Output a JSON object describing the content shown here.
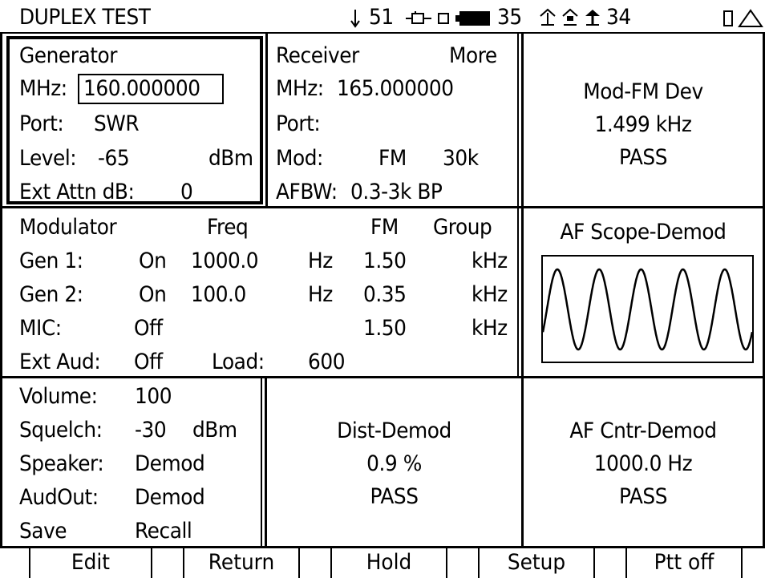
{
  "title_bar": {
    "title": "DUPLEX TEST",
    "arrow_value": "51",
    "battery_value": "35",
    "signal_value": "34"
  },
  "generator": {
    "title": "Generator",
    "mhz_label": "MHz:",
    "mhz_value": "160.000000",
    "port_label": "Port:",
    "port_value": "SWR",
    "level_label": "Level:",
    "level_value": "-65",
    "level_unit": "dBm",
    "ext_attn_label": "Ext Attn dB:",
    "ext_attn_value": "0"
  },
  "receiver": {
    "title": "Receiver",
    "more_label": "More",
    "mhz_label": "MHz:",
    "mhz_value": "165.000000",
    "port_label": "Port:",
    "mod_label": "Mod:",
    "mod_value": "FM",
    "mod_bw": "30k",
    "afbw_label": "AFBW:",
    "afbw_value": "0.3-3k BP"
  },
  "mod_fm_dev": {
    "title": "Mod-FM Dev",
    "value": "1.499 kHz",
    "status": "PASS"
  },
  "modulator": {
    "title": "Modulator",
    "freq_header": "Freq",
    "fm_header": "FM",
    "group_header": "Group",
    "rows": [
      {
        "name": "Gen 1:",
        "state": "On",
        "freq": "1000.0",
        "freq_unit": "Hz",
        "fm": "1.50",
        "fm_unit": "kHz"
      },
      {
        "name": "Gen 2:",
        "state": "On",
        "freq": "100.0",
        "freq_unit": "Hz",
        "fm": "0.35",
        "fm_unit": "kHz"
      },
      {
        "name": "MIC:",
        "state": "Off",
        "freq": "",
        "freq_unit": "",
        "fm": "1.50",
        "fm_unit": "kHz"
      }
    ],
    "ext_aud_label": "Ext Aud:",
    "ext_aud_value": "Off",
    "load_label": "Load:",
    "load_value": "600"
  },
  "af_scope": {
    "title": "AF Scope-Demod",
    "cycles": 5
  },
  "audio": {
    "volume_label": "Volume:",
    "volume_value": "100",
    "squelch_label": "Squelch:",
    "squelch_value": "-30",
    "squelch_unit": "dBm",
    "speaker_label": "Speaker:",
    "speaker_value": "Demod",
    "audout_label": "AudOut:",
    "audout_value": "Demod",
    "save_label": "Save",
    "recall_label": "Recall"
  },
  "dist_demod": {
    "title": "Dist-Demod",
    "value": "0.9 %",
    "status": "PASS"
  },
  "af_cntr": {
    "title": "AF Cntr-Demod",
    "value": "1000.0 Hz",
    "status": "PASS"
  },
  "softkeys": [
    "Edit",
    "Return",
    "Hold",
    "Setup",
    "Ptt off"
  ],
  "colors": {
    "foreground": "#000000",
    "background": "#ffffff"
  }
}
